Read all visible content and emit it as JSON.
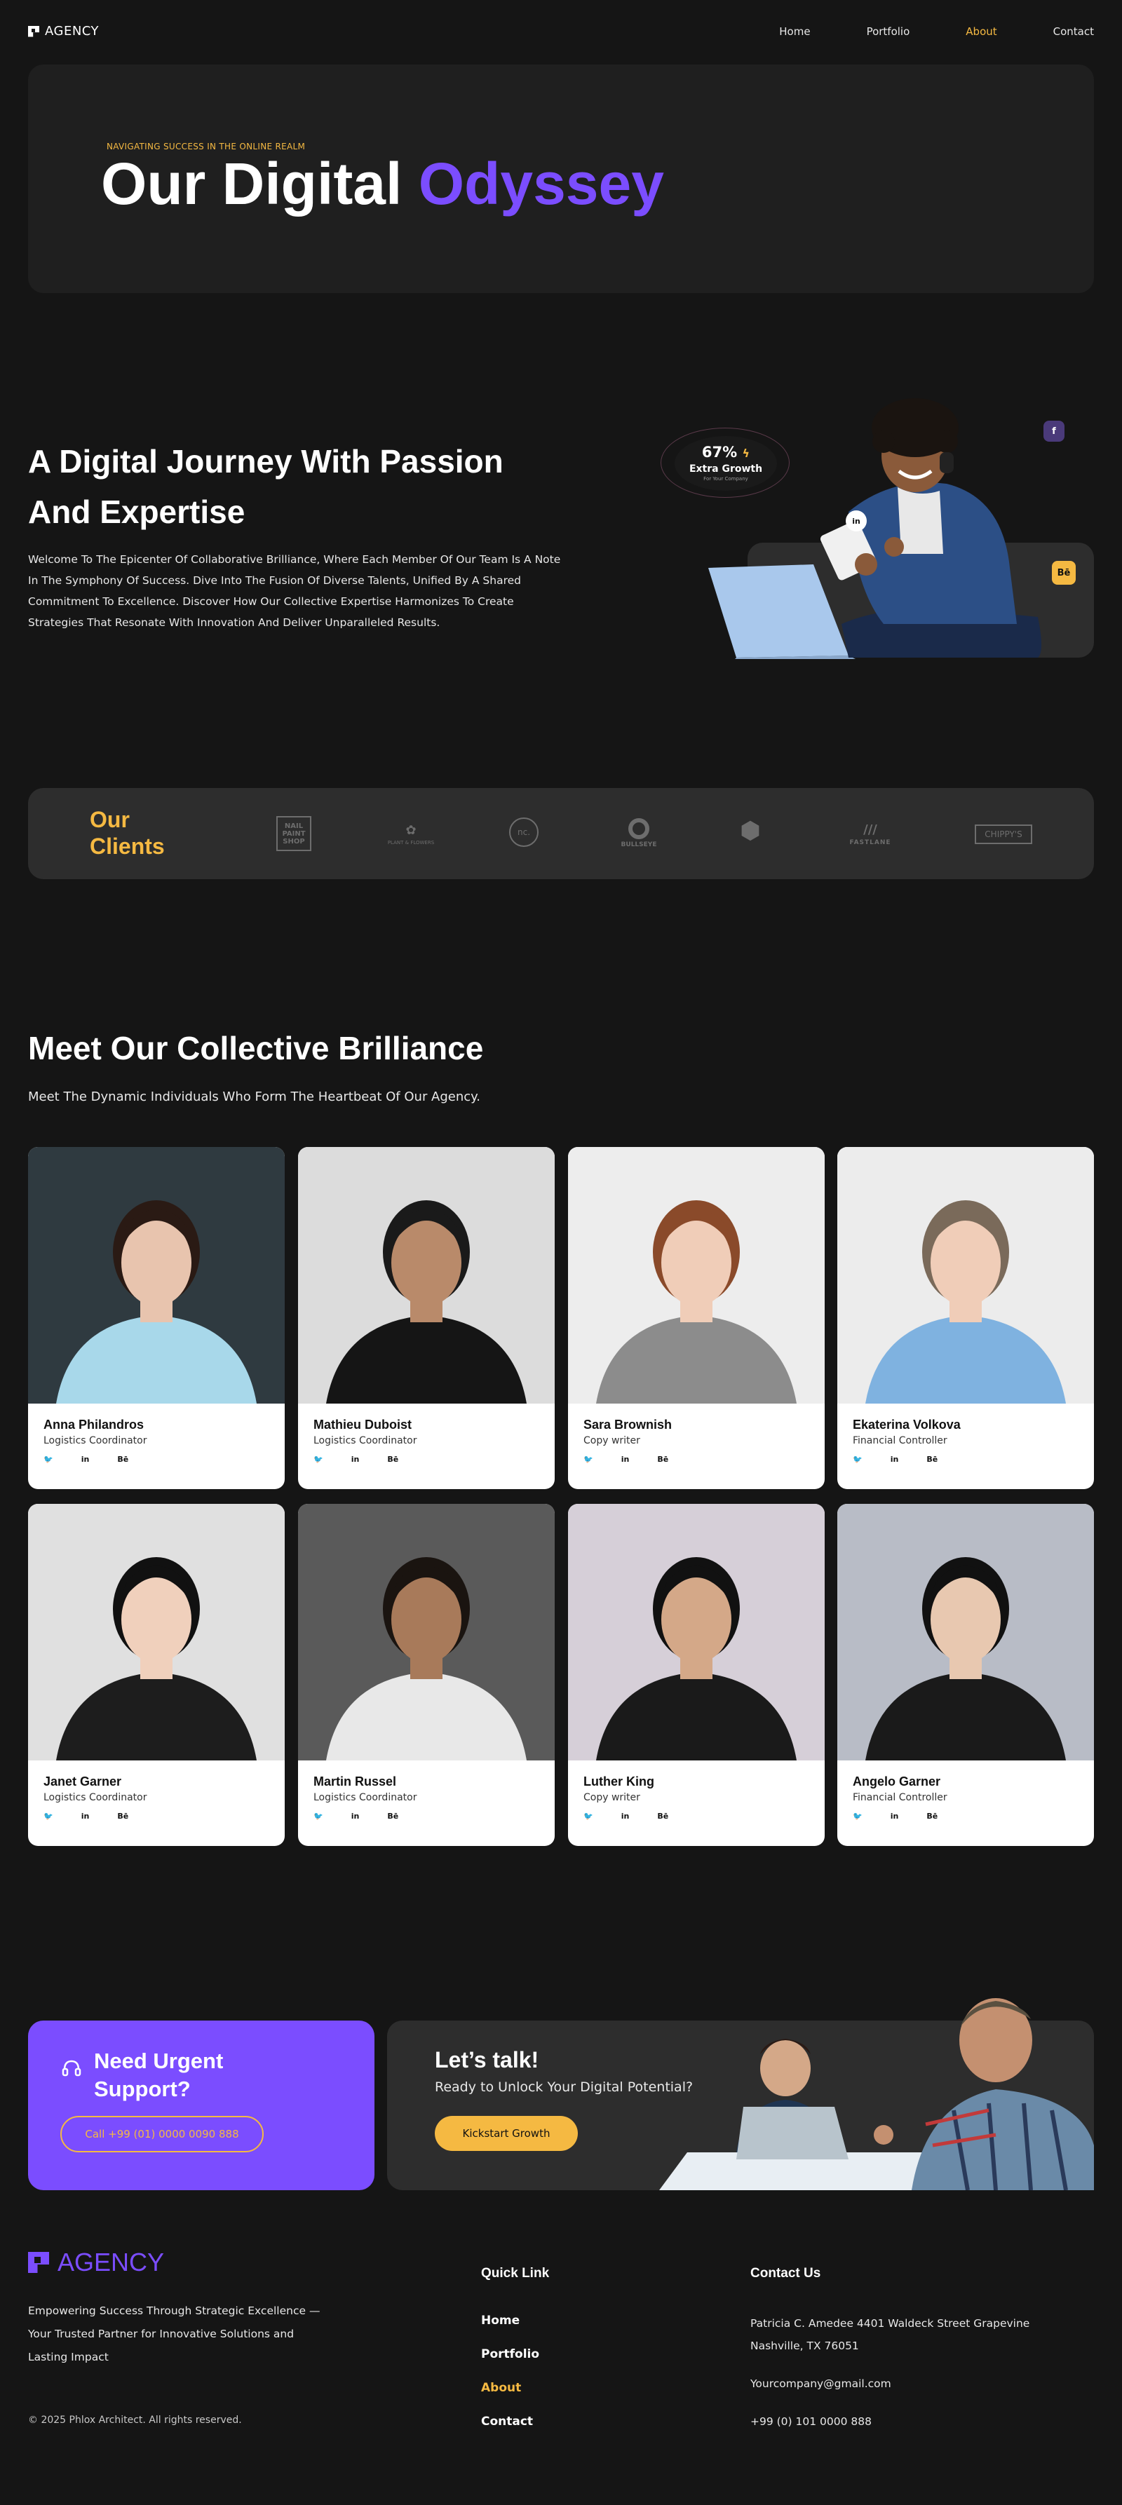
{
  "nav": {
    "logo": "AGENCY",
    "items": [
      {
        "label": "Home",
        "active": false
      },
      {
        "label": "Portfolio",
        "active": false
      },
      {
        "label": "About",
        "active": true
      },
      {
        "label": "Contact",
        "active": false
      }
    ]
  },
  "hero": {
    "eyebrow": "NAVIGATING SUCCESS IN THE ONLINE REALM",
    "title_main": "Our Digital ",
    "title_accent": "Odyssey"
  },
  "journey": {
    "title_line1": "A Digital Journey With Passion",
    "title_line2": "And Expertise",
    "text": "Welcome To The Epicenter Of Collaborative Brilliance, Where Each Member Of Our Team Is A Note In The Symphony Of Success. Dive Into The Fusion Of Diverse Talents, Unified By A Shared Commitment To Excellence. Discover How Our Collective Expertise Harmonizes To Create Strategies That Resonate With Innovation And Deliver Unparalleled Results.",
    "growth_pct": "67%",
    "growth_label": "Extra Growth",
    "growth_sub": "For Your Company",
    "chip_fb": "f",
    "chip_li": "in",
    "chip_be": "Bē"
  },
  "clients": {
    "title_line1": "Our",
    "title_line2": "Clients",
    "logos": [
      {
        "name": "NAIL PAINT SHOP"
      },
      {
        "name": "PLANT & FLOWERS"
      },
      {
        "name": "nc."
      },
      {
        "name": "BULLSEYE"
      },
      {
        "name": ""
      },
      {
        "name": "FASTLANE"
      },
      {
        "name": "CHIPPY'S"
      }
    ]
  },
  "team": {
    "title": "Meet Our Collective Brilliance",
    "subtitle": "Meet The Dynamic Individuals Who Form The Heartbeat Of Our Agency.",
    "social_tw": "🐦",
    "social_li": "in",
    "social_be": "Bē",
    "members": [
      {
        "name": "Anna Philandros",
        "role": "Logistics Coordinator",
        "bg": "#2f3a40",
        "skin": "#e8c4ae",
        "hair": "#2a1a14",
        "shirt": "#a8d8ea"
      },
      {
        "name": "Mathieu Duboist",
        "role": "Logistics Coordinator",
        "bg": "#dcdcdc",
        "skin": "#b98a6a",
        "hair": "#1a1a1a",
        "shirt": "#151515"
      },
      {
        "name": "Sara Brownish",
        "role": "Copy writer",
        "bg": "#ededed",
        "skin": "#f0cdb8",
        "hair": "#8a4a2a",
        "shirt": "#8c8c8c"
      },
      {
        "name": "Ekaterina Volkova",
        "role": "Financial Controller",
        "bg": "#ececec",
        "skin": "#f0cdb8",
        "hair": "#7a6a5a",
        "shirt": "#7fb2e0"
      },
      {
        "name": "Janet Garner",
        "role": "Logistics Coordinator",
        "bg": "#e0e0e0",
        "skin": "#f0d0bc",
        "hair": "#111111",
        "shirt": "#1d1d1d"
      },
      {
        "name": "Martin Russel",
        "role": "Logistics Coordinator",
        "bg": "#5a5a5a",
        "skin": "#a87a5a",
        "hair": "#1a1410",
        "shirt": "#e8e8e8"
      },
      {
        "name": "Luther King",
        "role": "Copy writer",
        "bg": "#d6cfd8",
        "skin": "#d4a888",
        "hair": "#111111",
        "shirt": "#1a1a1a"
      },
      {
        "name": "Angelo Garner",
        "role": "Financial Controller",
        "bg": "#b8bcc6",
        "skin": "#e8c8b0",
        "hair": "#111111",
        "shirt": "#1a1a1a"
      }
    ]
  },
  "support": {
    "title_line1": "Need Urgent",
    "title_line2": "Support?",
    "phone_button": "Call +99 (01) 0000 0090 888"
  },
  "talk": {
    "title": "Let’s talk!",
    "subtitle": "Ready to Unlock Your Digital Potential?",
    "button": "Kickstart Growth"
  },
  "footer": {
    "logo": "AGENCY",
    "desc": "Empowering Success Through Strategic Excellence — Your Trusted Partner for Innovative Solutions and Lasting Impact",
    "copyright": "© 2025 Phlox Architect. All rights reserved.",
    "quick_link_title": "Quick Link",
    "links": [
      {
        "label": "Home",
        "active": false
      },
      {
        "label": "Portfolio",
        "active": false
      },
      {
        "label": "About",
        "active": true
      },
      {
        "label": "Contact",
        "active": false
      }
    ],
    "contact_title": "Contact Us",
    "address": "Patricia C. Amedee 4401 Waldeck Street Grapevine Nashville, TX 76051",
    "email": "Yourcompany@gmail.com",
    "phone": "+99 (0) 101 0000 888"
  },
  "colors": {
    "accent_purple": "#7b4dff",
    "accent_yellow": "#f5b942",
    "bg": "#151515",
    "panel": "#1f1f1f",
    "card": "#2d2d2d"
  }
}
